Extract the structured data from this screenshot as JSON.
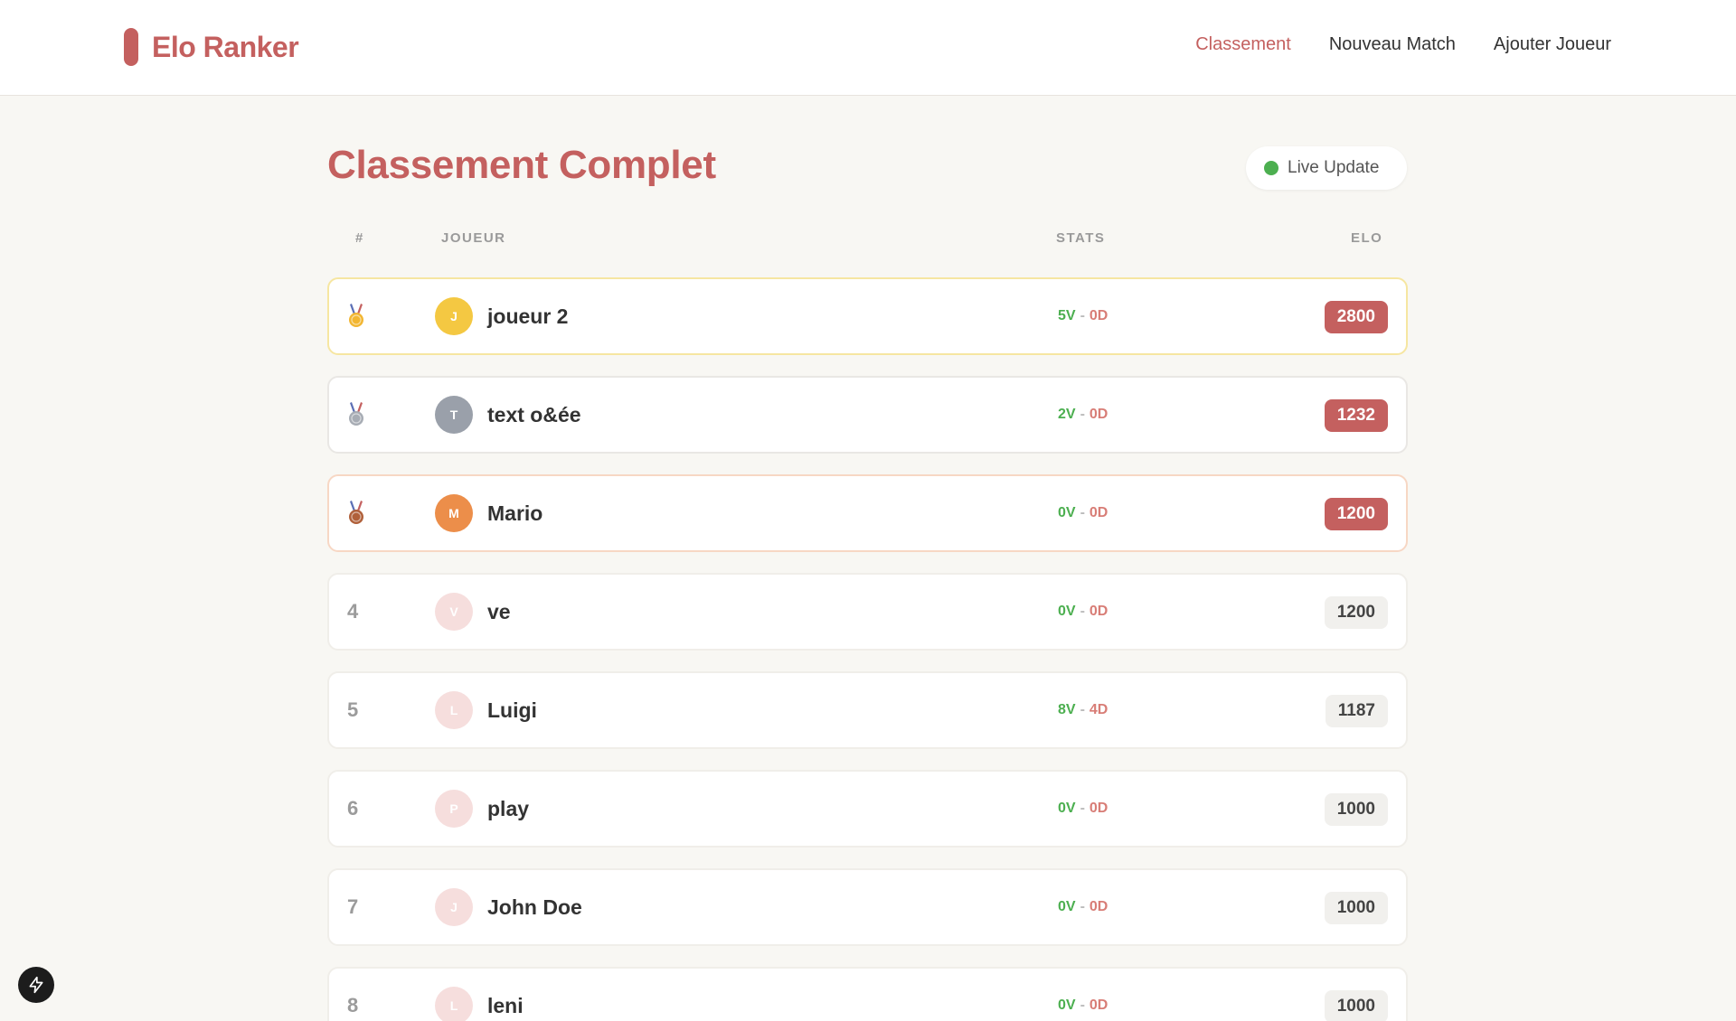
{
  "brand": {
    "name": "Elo Ranker"
  },
  "nav": {
    "links": [
      {
        "label": "Classement",
        "active": true
      },
      {
        "label": "Nouveau Match",
        "active": false
      },
      {
        "label": "Ajouter Joueur",
        "active": false
      }
    ]
  },
  "page": {
    "title": "Classement Complet"
  },
  "live": {
    "label": "Live Update",
    "color": "#4caf50"
  },
  "table": {
    "headers": {
      "rank": "#",
      "player": "JOUEUR",
      "stats": "STATS",
      "elo": "ELO"
    },
    "rows": [
      {
        "rank": "1",
        "medal": "gold-medal-icon",
        "initial": "J",
        "name": "joueur 2",
        "wins": "5V",
        "sep": "-",
        "losses": "0D",
        "elo": "2800",
        "avatar_color": "#f4c842"
      },
      {
        "rank": "2",
        "medal": "silver-medal-icon",
        "initial": "T",
        "name": "text o&ée",
        "wins": "2V",
        "sep": "-",
        "losses": "0D",
        "elo": "1232",
        "avatar_color": "#9aa0aa"
      },
      {
        "rank": "3",
        "medal": "bronze-medal-icon",
        "initial": "M",
        "name": "Mario",
        "wins": "0V",
        "sep": "-",
        "losses": "0D",
        "elo": "1200",
        "avatar_color": "#ec8e4a"
      },
      {
        "rank": "4",
        "initial": "V",
        "name": "ve",
        "wins": "0V",
        "sep": "-",
        "losses": "0D",
        "elo": "1200",
        "avatar_color": "#f6dedd"
      },
      {
        "rank": "5",
        "initial": "L",
        "name": "Luigi",
        "wins": "8V",
        "sep": "-",
        "losses": "4D",
        "elo": "1187",
        "avatar_color": "#f6dedd"
      },
      {
        "rank": "6",
        "initial": "P",
        "name": "play",
        "wins": "0V",
        "sep": "-",
        "losses": "0D",
        "elo": "1000",
        "avatar_color": "#f6dedd"
      },
      {
        "rank": "7",
        "initial": "J",
        "name": "John Doe",
        "wins": "0V",
        "sep": "-",
        "losses": "0D",
        "elo": "1000",
        "avatar_color": "#f6dedd"
      },
      {
        "rank": "8",
        "initial": "L",
        "name": "leni",
        "wins": "0V",
        "sep": "-",
        "losses": "0D",
        "elo": "1000",
        "avatar_color": "#f6dedd"
      }
    ]
  },
  "colors": {
    "accent": "#c4605f",
    "win": "#4caf50",
    "loss": "#d87d76"
  }
}
